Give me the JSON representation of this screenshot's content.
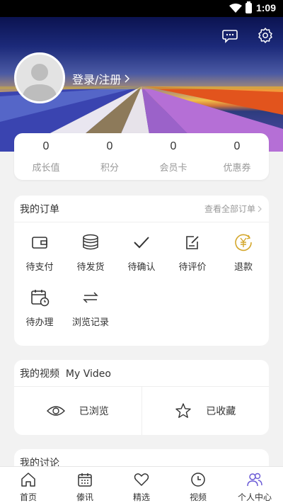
{
  "status_bar": {
    "time": "1:09"
  },
  "header": {
    "login_label": "登录/注册"
  },
  "stats": [
    {
      "value": "0",
      "label": "成长值"
    },
    {
      "value": "0",
      "label": "积分"
    },
    {
      "value": "0",
      "label": "会员卡"
    },
    {
      "value": "0",
      "label": "优惠券"
    }
  ],
  "orders": {
    "title": "我的订单",
    "view_all": "查看全部订单",
    "items": [
      {
        "label": "待支付",
        "icon": "wallet-icon"
      },
      {
        "label": "待发货",
        "icon": "coins-stack-icon"
      },
      {
        "label": "待确认",
        "icon": "checkmark-icon"
      },
      {
        "label": "待评价",
        "icon": "edit-note-icon"
      },
      {
        "label": "退款",
        "icon": "yen-refund-icon"
      },
      {
        "label": "待办理",
        "icon": "calendar-clock-icon"
      },
      {
        "label": "浏览记录",
        "icon": "swap-arrows-icon"
      }
    ]
  },
  "video": {
    "title": "我的视频  My Video",
    "items": [
      {
        "label": "已浏览",
        "icon": "eye-icon"
      },
      {
        "label": "已收藏",
        "icon": "star-icon"
      }
    ]
  },
  "discussion": {
    "title": "我的讨论"
  },
  "tabs": [
    {
      "label": "首页",
      "icon": "home-icon"
    },
    {
      "label": "傣讯",
      "icon": "calendar-grid-icon"
    },
    {
      "label": "精选",
      "icon": "heart-icon"
    },
    {
      "label": "视频",
      "icon": "clock-icon"
    },
    {
      "label": "个人中心",
      "icon": "people-icon",
      "active": true
    }
  ],
  "colors": {
    "accent_gold": "#d4a72c",
    "active_tab": "#6b5bd6",
    "text": "#333333",
    "muted": "#999999"
  }
}
